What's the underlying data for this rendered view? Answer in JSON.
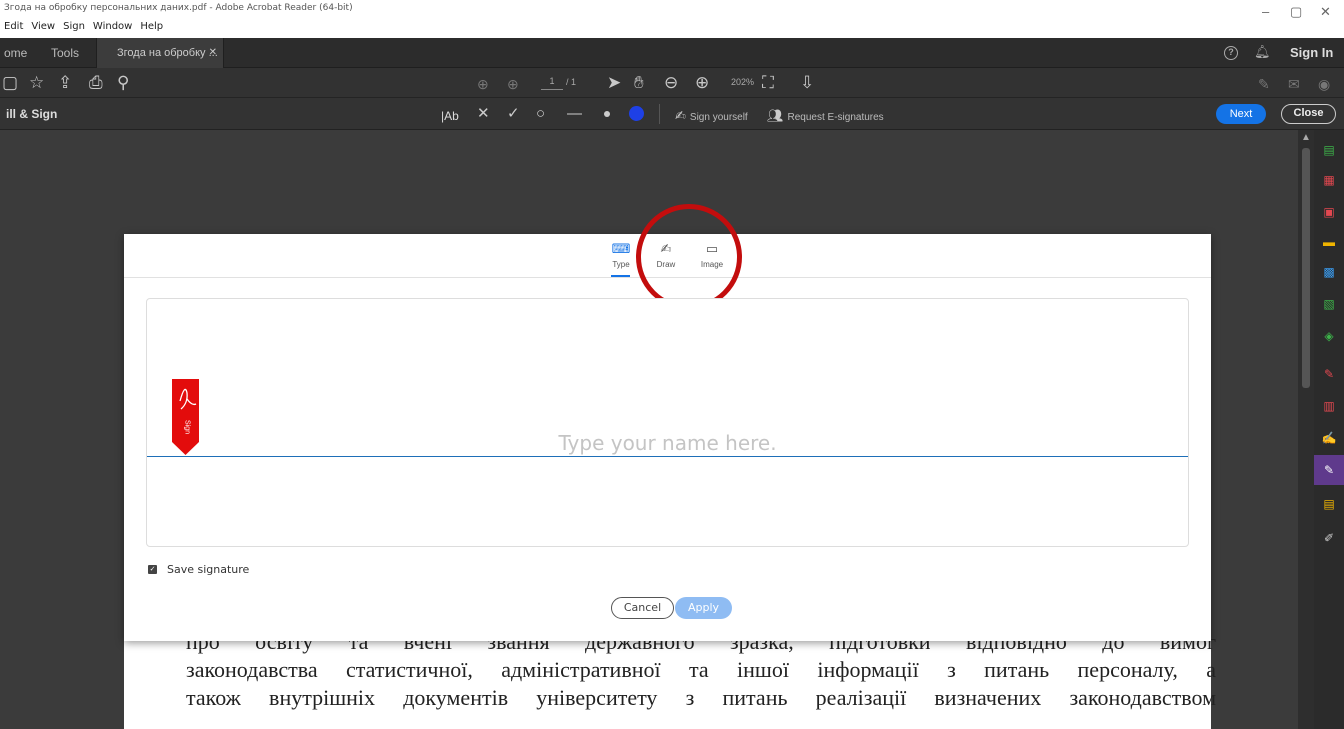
{
  "window": {
    "title": "Згода на обробку персональних даних.pdf - Adobe Acrobat Reader (64-bit)",
    "menu": [
      "Edit",
      "View",
      "Sign",
      "Window",
      "Help"
    ],
    "controls": [
      "–",
      "▢",
      "✕"
    ]
  },
  "tabs": {
    "home": "ome",
    "tools": "Tools",
    "document": "Згода на обробку ...",
    "sign_in": "Sign In"
  },
  "toolbar": {
    "page_current": "1",
    "page_total": "/ 1",
    "zoom": "202%"
  },
  "fill_sign": {
    "title": "ill & Sign",
    "text_tool": "|Ab",
    "sign_yourself": "Sign yourself",
    "request_esignatures": "Request E-signatures",
    "next": "Next",
    "close": "Close"
  },
  "dialog": {
    "tabs": [
      {
        "label": "Type",
        "icon": "keyboard-icon",
        "active": true
      },
      {
        "label": "Draw",
        "icon": "pen-icon",
        "active": false
      },
      {
        "label": "Image",
        "icon": "image-icon",
        "active": false
      }
    ],
    "placeholder": "Type your name here.",
    "sign_flag_text": "Sign",
    "save_signature": "Save signature",
    "save_checked": true,
    "cancel": "Cancel",
    "apply": "Apply"
  },
  "document_text": [
    "про освіту та вчені звання державного зразка, підготовки відповідно до вимог",
    "законодавства статистичної, адміністративної та іншої інформації з питань персоналу, а",
    "також внутрішніх документів університету з питань реалізації визначених законодавством"
  ],
  "colors": {
    "accent": "#1473e6",
    "highlight_circle": "#c30d0d",
    "acrobat_red": "#e30c0c"
  }
}
